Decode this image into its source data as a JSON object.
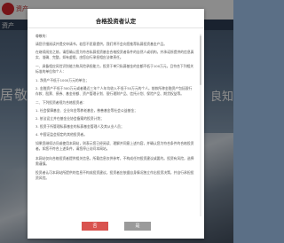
{
  "background": {
    "logo_text": "资产",
    "nav_text": "资产",
    "slogan_left": "居敬",
    "slogan_right": "良知"
  },
  "modal": {
    "title": "合格投资者认定",
    "paragraphs": [
      "尊敬的：",
      "请您仔细阅读并提交申请书。若您不愿意提供，我们将不会向您推荐私募投资基金产品。",
      "在继续阅览之前，请您确认您为符合私募投资基金合格投资者条件的自然人或机构，并承诺所提供的信息真实、准确、完整，如有虚假，由您自行承担相应法律责任。",
      "一、具备相应风险识别能力和风险承担能力，投资于单只私募基金的金额不低于100万元，且符合下列相关标准的单位和个人：",
      "1. 净资产不低于1000万元的单位；",
      "2. 金融资产不低于300万元或者最近三年个人年均收入不低于50万元的个人。前款所称金融资产包括银行存款、股票、债券、基金份额、资产管理计划、银行理财产品、信托计划、保险产品、期货权益等。",
      "二、下列投资者视为合格投资者：",
      "1. 社会保障基金、企业年金等养老基金，慈善基金等社会公益基金；",
      "2. 依法设立并在基金业协会备案的投资计划；",
      "3. 投资于所管理私募基金的私募基金管理人及其从业人员；",
      "4. 中国证监会规定的其他投资者。",
      "如果您继续访问或使用本网站，则表示您已经阅读、理解并同意上述内容，并确认您为符合条件的合格投资者。如您不符合上述条件，请您停止访问本网站。",
      "本网站仅向合格投资者提供相关信息，所载信息仅供参考，不构成任何投资建议或要约。投资有风险，选择需谨慎。",
      "投资者认可本网站所提供的信息不构成投资建议，投资者应依据自身情况独立作出投资决策，并自行承担投资风险。"
    ],
    "no_button": "否",
    "yes_button": "是"
  }
}
